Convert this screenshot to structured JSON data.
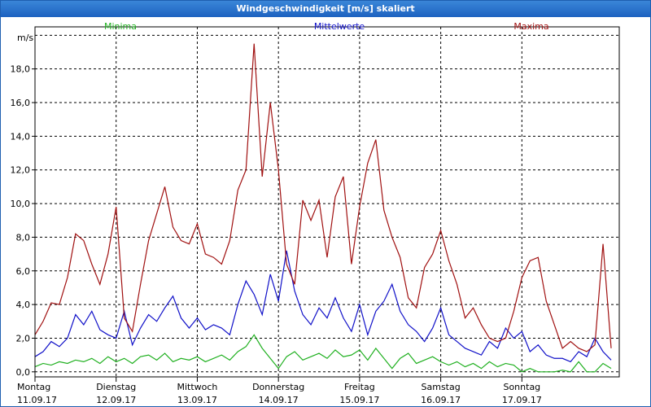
{
  "window": {
    "title": "Windgeschwindigkeit [m/s] skaliert"
  },
  "colors": {
    "minima": "#20b020",
    "mittel": "#1010c8",
    "maxima": "#a01010",
    "grid": "#000000",
    "frame": "#000000"
  },
  "chart_data": {
    "type": "line",
    "ylabel": "m/s",
    "ylim": [
      -0.3,
      20.5
    ],
    "yticks": [
      0,
      2,
      4,
      6,
      8,
      10,
      12,
      14,
      16,
      18
    ],
    "ytick_labels": [
      "0,0",
      "2,0",
      "4,0",
      "6,0",
      "8,0",
      "10,0",
      "12,0",
      "14,0",
      "16,0",
      "18,0"
    ],
    "xlim": [
      0,
      7.2
    ],
    "grid": true,
    "legend_placement": "top",
    "days": [
      {
        "weekday": "Montag",
        "date": "11.09.17"
      },
      {
        "weekday": "Dienstag",
        "date": "12.09.17"
      },
      {
        "weekday": "Mittwoch",
        "date": "13.09.17"
      },
      {
        "weekday": "Donnerstag",
        "date": "14.09.17"
      },
      {
        "weekday": "Freitag",
        "date": "15.09.17"
      },
      {
        "weekday": "Samstag",
        "date": "16.09.17"
      },
      {
        "weekday": "Sonntag",
        "date": "17.09.17"
      }
    ],
    "series": [
      {
        "name": "Minima",
        "color": "#20b020",
        "x": [
          0,
          0.1,
          0.2,
          0.3,
          0.4,
          0.5,
          0.6,
          0.7,
          0.8,
          0.9,
          1.0,
          1.1,
          1.2,
          1.3,
          1.4,
          1.5,
          1.6,
          1.7,
          1.8,
          1.9,
          2.0,
          2.1,
          2.2,
          2.3,
          2.4,
          2.5,
          2.6,
          2.7,
          2.8,
          2.9,
          3.0,
          3.1,
          3.2,
          3.3,
          3.4,
          3.5,
          3.6,
          3.7,
          3.8,
          3.9,
          4.0,
          4.1,
          4.2,
          4.3,
          4.4,
          4.5,
          4.6,
          4.7,
          4.8,
          4.9,
          5.0,
          5.1,
          5.2,
          5.3,
          5.4,
          5.5,
          5.6,
          5.7,
          5.8,
          5.9,
          6.0,
          6.1,
          6.2,
          6.3,
          6.4,
          6.5,
          6.6,
          6.7,
          6.8,
          6.9,
          7.0,
          7.1
        ],
        "values": [
          0.3,
          0.5,
          0.4,
          0.6,
          0.5,
          0.7,
          0.6,
          0.8,
          0.5,
          0.9,
          0.6,
          0.8,
          0.5,
          0.9,
          1.0,
          0.7,
          1.1,
          0.6,
          0.8,
          0.7,
          0.9,
          0.6,
          0.8,
          1.0,
          0.7,
          1.2,
          1.5,
          2.2,
          1.4,
          0.8,
          0.2,
          0.9,
          1.2,
          0.7,
          0.9,
          1.1,
          0.8,
          1.3,
          0.9,
          1.0,
          1.3,
          0.7,
          1.4,
          0.8,
          0.2,
          0.8,
          1.1,
          0.5,
          0.7,
          0.9,
          0.6,
          0.4,
          0.6,
          0.3,
          0.5,
          0.2,
          0.6,
          0.3,
          0.5,
          0.4,
          0.0,
          0.2,
          0.0,
          0.0,
          0.0,
          0.1,
          0.0,
          0.6,
          0.0,
          0.0,
          0.5,
          0.2
        ]
      },
      {
        "name": "Mittelwerte",
        "color": "#1010c8",
        "x": [
          0,
          0.1,
          0.2,
          0.3,
          0.4,
          0.5,
          0.6,
          0.7,
          0.8,
          0.9,
          1.0,
          1.1,
          1.2,
          1.3,
          1.4,
          1.5,
          1.6,
          1.7,
          1.8,
          1.9,
          2.0,
          2.1,
          2.2,
          2.3,
          2.4,
          2.5,
          2.6,
          2.7,
          2.8,
          2.9,
          3.0,
          3.1,
          3.2,
          3.3,
          3.4,
          3.5,
          3.6,
          3.7,
          3.8,
          3.9,
          4.0,
          4.1,
          4.2,
          4.3,
          4.4,
          4.5,
          4.6,
          4.7,
          4.8,
          4.9,
          5.0,
          5.1,
          5.2,
          5.3,
          5.4,
          5.5,
          5.6,
          5.7,
          5.8,
          5.9,
          6.0,
          6.1,
          6.2,
          6.3,
          6.4,
          6.5,
          6.6,
          6.7,
          6.8,
          6.9,
          7.0,
          7.1
        ],
        "values": [
          0.9,
          1.2,
          1.8,
          1.5,
          2.0,
          3.4,
          2.8,
          3.6,
          2.5,
          2.2,
          2.0,
          3.6,
          1.6,
          2.6,
          3.4,
          3.0,
          3.8,
          4.5,
          3.2,
          2.6,
          3.2,
          2.5,
          2.8,
          2.6,
          2.2,
          4.0,
          5.4,
          4.6,
          3.4,
          5.8,
          4.2,
          7.2,
          4.8,
          3.4,
          2.8,
          3.8,
          3.2,
          4.4,
          3.2,
          2.4,
          4.0,
          2.2,
          3.6,
          4.2,
          5.2,
          3.6,
          2.8,
          2.4,
          1.8,
          2.6,
          3.8,
          2.2,
          1.8,
          1.4,
          1.2,
          1.0,
          1.8,
          1.4,
          2.6,
          2.0,
          2.4,
          1.2,
          1.6,
          1.0,
          0.8,
          0.8,
          0.6,
          1.2,
          0.9,
          2.0,
          1.2,
          0.7
        ]
      },
      {
        "name": "Maxima",
        "color": "#a01010",
        "x": [
          0,
          0.1,
          0.2,
          0.3,
          0.4,
          0.5,
          0.6,
          0.7,
          0.8,
          0.9,
          1.0,
          1.1,
          1.2,
          1.3,
          1.4,
          1.5,
          1.6,
          1.7,
          1.8,
          1.9,
          2.0,
          2.1,
          2.2,
          2.3,
          2.4,
          2.5,
          2.6,
          2.7,
          2.8,
          2.9,
          3.0,
          3.1,
          3.2,
          3.3,
          3.4,
          3.5,
          3.6,
          3.7,
          3.8,
          3.9,
          4.0,
          4.1,
          4.2,
          4.3,
          4.4,
          4.5,
          4.6,
          4.7,
          4.8,
          4.9,
          5.0,
          5.1,
          5.2,
          5.3,
          5.4,
          5.5,
          5.6,
          5.7,
          5.8,
          5.9,
          6.0,
          6.1,
          6.2,
          6.3,
          6.4,
          6.5,
          6.6,
          6.7,
          6.8,
          6.9,
          7.0,
          7.1
        ],
        "values": [
          2.2,
          3.0,
          4.1,
          4.0,
          5.6,
          8.2,
          7.8,
          6.4,
          5.2,
          7.0,
          9.8,
          3.2,
          2.4,
          5.2,
          7.8,
          9.4,
          11.0,
          8.6,
          7.8,
          7.6,
          8.8,
          7.0,
          6.8,
          6.4,
          7.8,
          10.8,
          12.0,
          19.5,
          11.6,
          16.0,
          12.0,
          6.4,
          5.2,
          10.2,
          9.0,
          10.2,
          6.8,
          10.4,
          11.6,
          6.4,
          9.8,
          12.4,
          13.8,
          9.6,
          8.0,
          6.8,
          4.4,
          3.8,
          6.2,
          7.0,
          8.4,
          6.6,
          5.2,
          3.2,
          3.8,
          2.8,
          2.0,
          1.8,
          2.0,
          3.6,
          5.6,
          6.6,
          6.8,
          4.2,
          2.8,
          1.4,
          1.8,
          1.4,
          1.2,
          1.6,
          7.6,
          1.4
        ]
      }
    ]
  }
}
